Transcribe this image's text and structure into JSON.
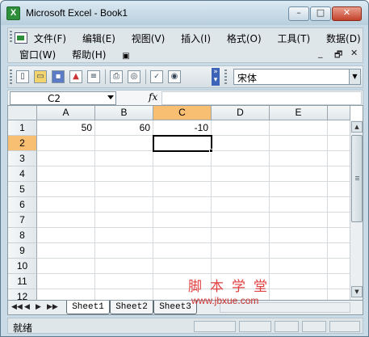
{
  "window": {
    "title": "Microsoft Excel - Book1",
    "app_icon": "excel-icon",
    "buttons": {
      "minimize": "–",
      "maximize": "□",
      "close": "✕"
    }
  },
  "menubar": {
    "items": [
      "文件(F)",
      "编辑(E)",
      "视图(V)",
      "插入(I)",
      "格式(O)",
      "工具(T)",
      "数据(D)"
    ],
    "items_row2": [
      "窗口(W)",
      "帮助(H)"
    ],
    "doc_controls": {
      "minimize": "_",
      "restore": "🗗",
      "close": "✕"
    }
  },
  "toolbar": {
    "icons": [
      "new-icon",
      "open-icon",
      "save-icon",
      "permission-icon",
      "print-preview-icon",
      "print-icon",
      "zoom-preview-icon",
      "spelling-icon",
      "research-icon"
    ],
    "font_name": "宋体"
  },
  "formula_bar": {
    "name_box": "C2",
    "fx_label": "fx",
    "formula": ""
  },
  "grid": {
    "columns": [
      "A",
      "B",
      "C",
      "D",
      "E"
    ],
    "active_column": "C",
    "rows": [
      "1",
      "2",
      "3",
      "4",
      "5",
      "6",
      "7",
      "8",
      "9",
      "10",
      "11",
      "12"
    ],
    "active_row": "2",
    "cells": {
      "A1": "50",
      "B1": "60",
      "C1": "-10"
    },
    "selected_cell": "C2"
  },
  "sheets": {
    "tabs": [
      "Sheet1",
      "Sheet2",
      "Sheet3"
    ],
    "active": "Sheet1",
    "nav": [
      "◀◀",
      "◀",
      "▶",
      "▶▶"
    ]
  },
  "status": {
    "text": "就绪"
  },
  "watermark": {
    "chinese": "脚本学堂",
    "url": "www.jbxue.com"
  }
}
